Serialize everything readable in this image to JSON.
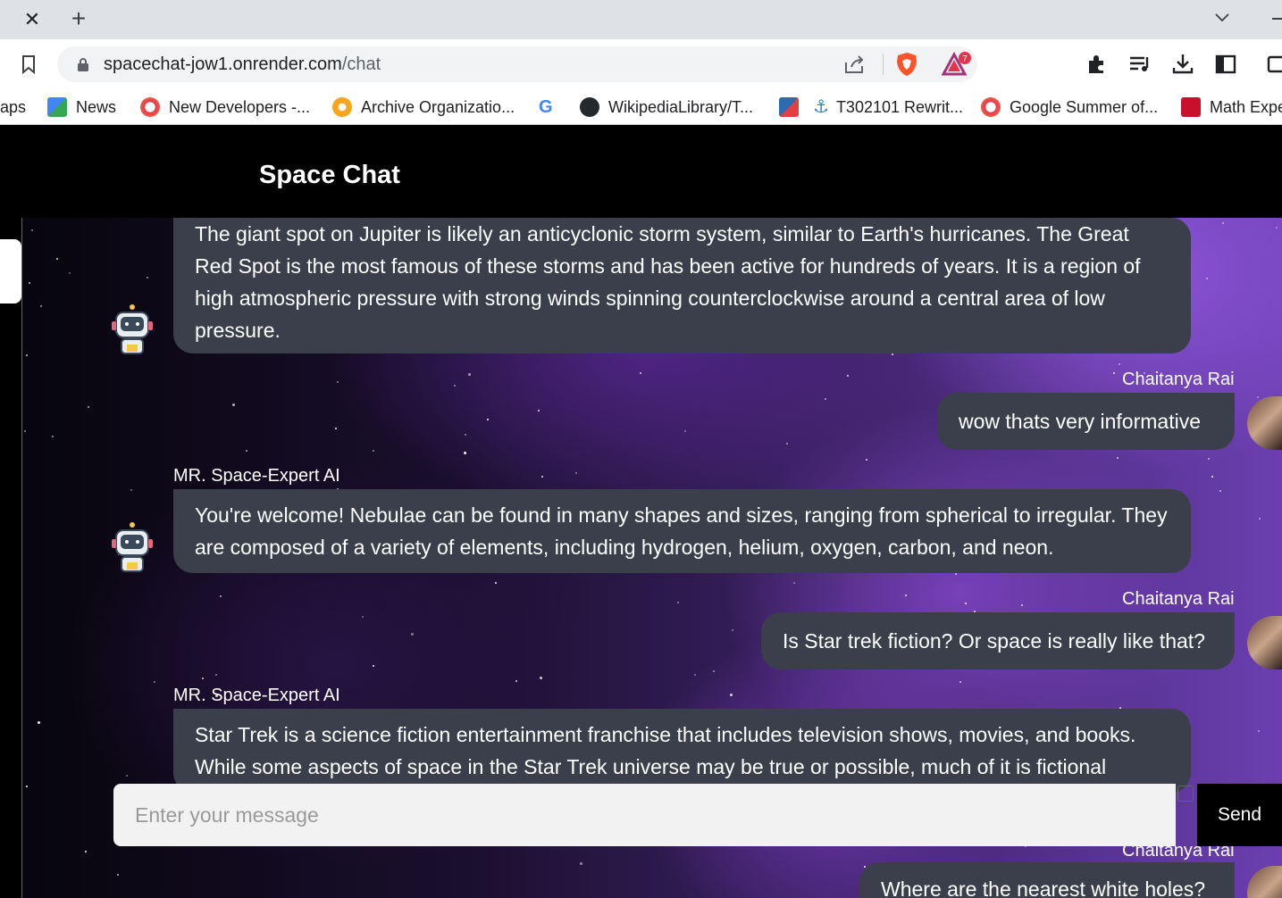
{
  "browser": {
    "url_host": "spacechat-jow1.onrender.com",
    "url_path": "/chat",
    "rewards_badge": "7"
  },
  "bookmarks": [
    {
      "label": "aps",
      "icon": "apps-icon"
    },
    {
      "label": "News",
      "icon": "news-icon"
    },
    {
      "label": "New Developers -...",
      "icon": "outreachy-icon"
    },
    {
      "label": "Archive Organizatio...",
      "icon": "archive-icon"
    },
    {
      "label": "",
      "icon": "google-icon"
    },
    {
      "label": "WikipediaLibrary/T...",
      "icon": "github-icon"
    },
    {
      "label": "",
      "icon": "phabricator-icon"
    },
    {
      "label": "T302101 Rewrit...",
      "icon": "anchor-icon"
    },
    {
      "label": "Google Summer of...",
      "icon": "gsoc-icon"
    },
    {
      "label": "Math Expe",
      "icon": "math-icon"
    }
  ],
  "app": {
    "title": "Space Chat"
  },
  "messages": [
    {
      "role": "bot",
      "sender": "",
      "text": "The giant spot on Jupiter is likely an anticyclonic storm system, similar to Earth's hurricanes. The Great Red Spot is the most famous of these storms and has been active for hundreds of years. It is a region of high atmospheric pressure with strong winds spinning counterclockwise around a central area of low pressure."
    },
    {
      "role": "user",
      "sender": "Chaitanya Rai",
      "text": "wow thats very informative"
    },
    {
      "role": "bot",
      "sender": "MR. Space-Expert AI",
      "text": "You're welcome! Nebulae can be found in many shapes and sizes, ranging from spherical to irregular. They are composed of a variety of elements, including hydrogen, helium, oxygen, carbon, and neon."
    },
    {
      "role": "user",
      "sender": "Chaitanya Rai",
      "text": "Is Star trek fiction? Or space is really like that?"
    },
    {
      "role": "bot",
      "sender": "MR. Space-Expert AI",
      "text": "Star Trek is a science fiction entertainment franchise that includes television shows, movies, and books. While some aspects of space in the Star Trek universe may be true or possible, much of it is fictional"
    },
    {
      "role": "user",
      "sender": "Chaitanya Rai",
      "text": "Where are the nearest white holes?"
    }
  ],
  "composer": {
    "placeholder": "Enter your message",
    "send_label": "Send"
  }
}
